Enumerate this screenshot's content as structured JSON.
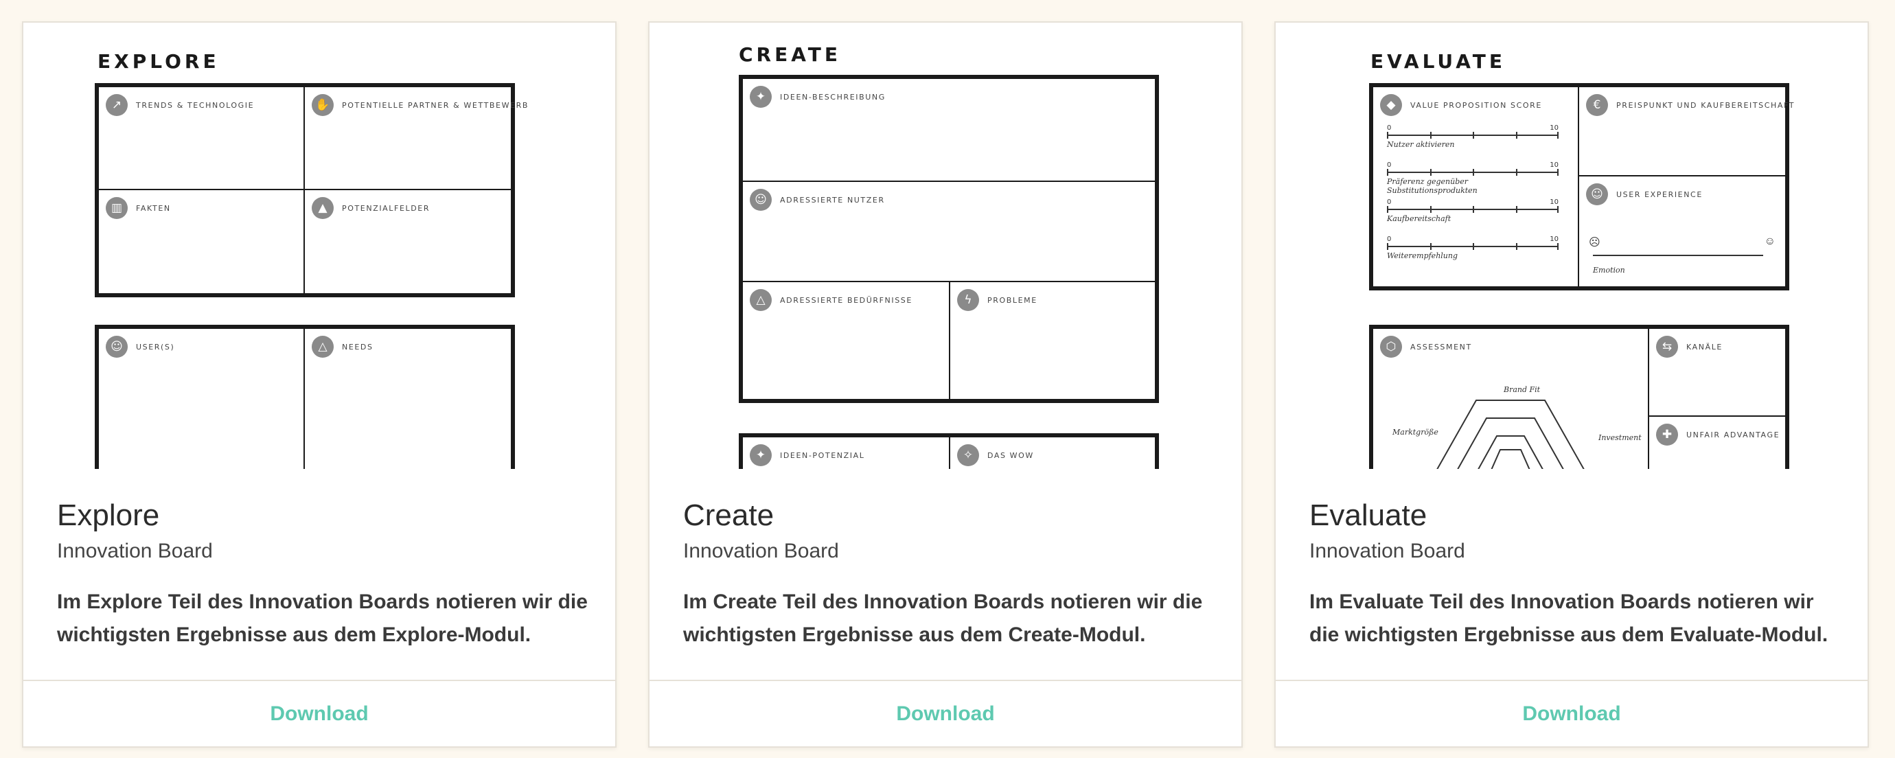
{
  "cards": [
    {
      "title": "Explore",
      "subtitle": "Innovation Board",
      "description": "Im Explore Teil des Innovation Boards notieren wir die wichtigsten Ergebnisse aus dem Explore-Modul.",
      "download_label": "Download",
      "board": {
        "heading": "EXPLORE",
        "cells": [
          {
            "label": "TRENDS & TECHNOLOGIE",
            "icon": "trend-icon",
            "glyph": "↗"
          },
          {
            "label": "POTENTIELLE PARTNER & WETTBEWERB",
            "icon": "handshake-icon",
            "glyph": "✋"
          },
          {
            "label": "FAKTEN",
            "icon": "bar-chart-icon",
            "glyph": "▥"
          },
          {
            "label": "POTENZIALFELDER",
            "icon": "rocket-icon",
            "glyph": "▲"
          },
          {
            "label": "USER(S)",
            "icon": "user-icon",
            "glyph": "☺"
          },
          {
            "label": "NEEDS",
            "icon": "pyramid-icon",
            "glyph": "△"
          }
        ]
      }
    },
    {
      "title": "Create",
      "subtitle": "Innovation Board",
      "description": "Im Create Teil des Innovation Boards notieren wir die wichtigsten Ergebnisse aus dem Create-Modul.",
      "download_label": "Download",
      "board": {
        "heading": "CREATE",
        "cells": [
          {
            "label": "IDEEN-BESCHREIBUNG",
            "icon": "lightbulb-icon",
            "glyph": "✦"
          },
          {
            "label": "ADRESSIERTE NUTZER",
            "icon": "user-icon",
            "glyph": "☺"
          },
          {
            "label": "ADRESSIERTE BEDÜRFNISSE",
            "icon": "pyramid-icon",
            "glyph": "△"
          },
          {
            "label": "PROBLEME",
            "icon": "lightning-icon",
            "glyph": "ϟ"
          },
          {
            "label": "IDEEN-POTENZIAL",
            "icon": "lightbulb-icon",
            "glyph": "✦"
          },
          {
            "label": "DAS WOW",
            "icon": "sparkle-icon",
            "glyph": "✧"
          }
        ]
      }
    },
    {
      "title": "Evaluate",
      "subtitle": "Innovation Board",
      "description": "Im Evaluate Teil des Innovation Boards notieren wir die wichtigsten Ergebnisse aus dem Evaluate-Modul.",
      "download_label": "Download",
      "board": {
        "heading": "EVALUATE",
        "cells": [
          {
            "label": "VALUE PROPOSITION SCORE",
            "icon": "diamond-icon",
            "glyph": "◆"
          },
          {
            "label": "PREISPUNKT UND KAUFBEREITSCHAFT",
            "icon": "banknote-icon",
            "glyph": "€"
          },
          {
            "label": "USER EXPERIENCE",
            "icon": "user-cycle-icon",
            "glyph": "☺"
          },
          {
            "label": "ASSESSMENT",
            "icon": "hexagon-icon",
            "glyph": "⬡"
          },
          {
            "label": "KANÄLE",
            "icon": "arrows-icon",
            "glyph": "⇆"
          },
          {
            "label": "UNFAIR ADVANTAGE",
            "icon": "cross-icon",
            "glyph": "✚"
          }
        ],
        "scales": [
          {
            "min": "0",
            "max": "10",
            "caption": "Nutzer aktivieren"
          },
          {
            "min": "0",
            "max": "10",
            "caption": "Präferenz gegenüber Substitutionsprodukten"
          },
          {
            "min": "0",
            "max": "10",
            "caption": "Kaufbereitschaft"
          },
          {
            "min": "0",
            "max": "10",
            "caption": "Weiterempfehlung"
          }
        ],
        "emotion_caption": "Emotion",
        "assessment_labels": {
          "top": "Brand Fit",
          "left": "Marktgröße",
          "right": "Investment"
        }
      }
    }
  ]
}
